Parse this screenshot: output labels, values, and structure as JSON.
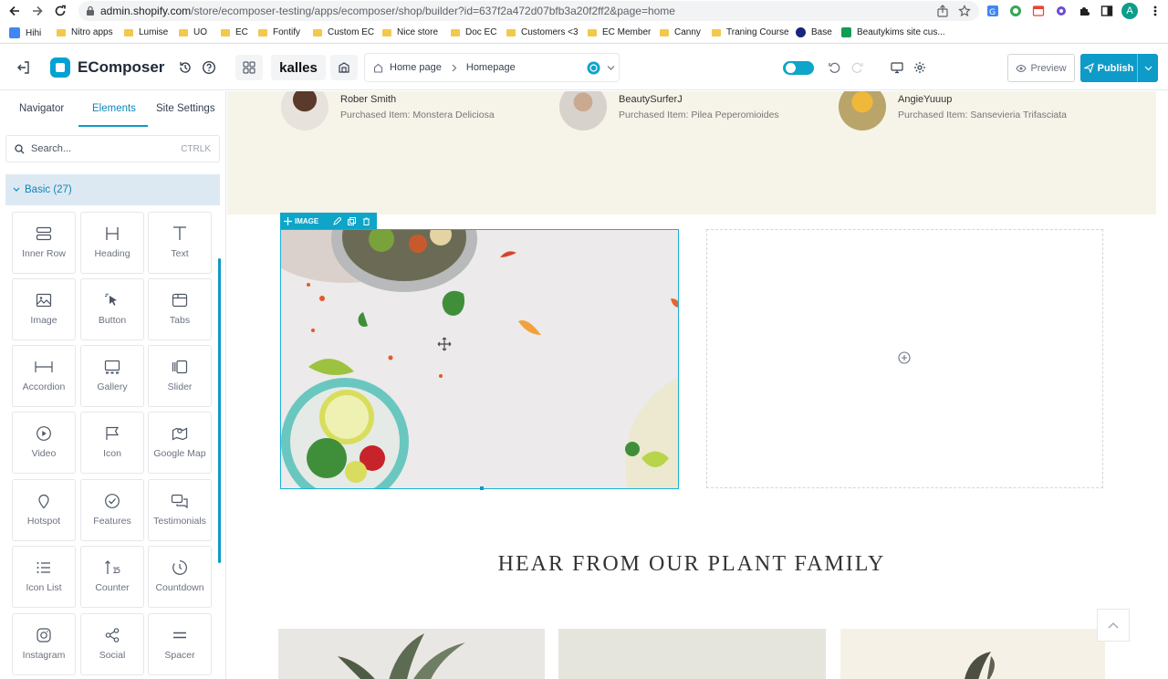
{
  "browser": {
    "url_host": "admin.shopify.com",
    "url_path": "/store/ecomposer-testing/apps/ecomposer/shop/builder?id=637f2a472d07bfb3a20f2ff2&page=home",
    "profile_initial": "A",
    "bookmarks": [
      "Hihi",
      "Nitro apps",
      "Lumise",
      "UO",
      "EC",
      "Fontify",
      "Custom EC",
      "Nice store",
      "Doc EC",
      "Customers <3",
      "EC Member",
      "Canny",
      "Traning Course",
      "Base",
      "Beautykims site cus..."
    ]
  },
  "builder": {
    "brand": "EComposer",
    "theme": "kalles",
    "breadcrumb": [
      "Home page",
      "Homepage"
    ],
    "preview_label": "Preview",
    "publish_label": "Publish",
    "accent": "#0e9bc8"
  },
  "sidebar": {
    "tabs": [
      "Navigator",
      "Elements",
      "Site Settings"
    ],
    "active_tab": "Elements",
    "search_placeholder": "Search...",
    "search_shortcut": "CTRLK",
    "group_label": "Basic (27)",
    "elements": [
      {
        "label": "Inner Row",
        "icon": "inner-row-icon"
      },
      {
        "label": "Heading",
        "icon": "heading-icon"
      },
      {
        "label": "Text",
        "icon": "text-icon"
      },
      {
        "label": "Image",
        "icon": "image-icon"
      },
      {
        "label": "Button",
        "icon": "button-icon"
      },
      {
        "label": "Tabs",
        "icon": "tabs-icon"
      },
      {
        "label": "Accordion",
        "icon": "accordion-icon"
      },
      {
        "label": "Gallery",
        "icon": "gallery-icon"
      },
      {
        "label": "Slider",
        "icon": "slider-icon"
      },
      {
        "label": "Video",
        "icon": "video-icon"
      },
      {
        "label": "Icon",
        "icon": "flag-icon"
      },
      {
        "label": "Google Map",
        "icon": "map-icon"
      },
      {
        "label": "Hotspot",
        "icon": "hotspot-icon"
      },
      {
        "label": "Features",
        "icon": "features-icon"
      },
      {
        "label": "Testimonials",
        "icon": "testimonials-icon"
      },
      {
        "label": "Icon List",
        "icon": "icon-list-icon"
      },
      {
        "label": "Counter",
        "icon": "counter-icon"
      },
      {
        "label": "Countdown",
        "icon": "countdown-icon"
      },
      {
        "label": "Instagram",
        "icon": "instagram-icon"
      },
      {
        "label": "Social",
        "icon": "social-icon"
      },
      {
        "label": "Spacer",
        "icon": "spacer-icon"
      }
    ]
  },
  "canvas": {
    "reviews": [
      {
        "name": "Rober Smith",
        "item": "Purchased Item: Monstera Deliciosa"
      },
      {
        "name": "BeautySurferJ",
        "item": "Purchased Item: Pilea Peperomioides"
      },
      {
        "name": "AngieYuuup",
        "item": "Purchased Item: Sansevieria Trifasciata"
      }
    ],
    "image_toolbar_label": "IMAGE",
    "section_heading": "HEAR FROM OUR PLANT FAMILY"
  }
}
